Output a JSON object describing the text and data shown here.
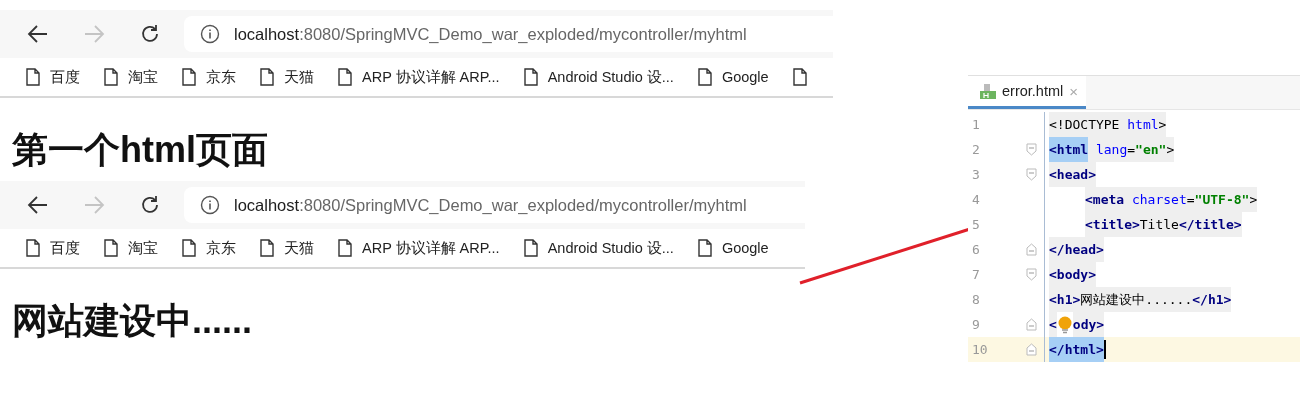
{
  "browsers": [
    {
      "nav": [
        {
          "kind": "back",
          "disabled": false
        },
        {
          "kind": "forward",
          "disabled": true
        },
        {
          "kind": "reload",
          "disabled": false
        }
      ],
      "address": {
        "host": "localhost",
        "path": ":8080/SpringMVC_Demo_war_exploded/mycontroller/myhtml"
      },
      "bookmarks": [
        "百度",
        "淘宝",
        "京东",
        "天猫",
        "ARP 协议详解 ARP...",
        "Android Studio 设...",
        "Google"
      ],
      "heading": "第一个html页面"
    },
    {
      "nav": [
        {
          "kind": "back",
          "disabled": false
        },
        {
          "kind": "forward",
          "disabled": true
        },
        {
          "kind": "reload",
          "disabled": false
        }
      ],
      "address": {
        "host": "localhost",
        "path": ":8080/SpringMVC_Demo_war_exploded/mycontroller/myhtml"
      },
      "bookmarks": [
        "百度",
        "淘宝",
        "京东",
        "天猫",
        "ARP 协议详解 ARP...",
        "Android Studio 设...",
        "Google"
      ],
      "heading": "网站建设中......"
    }
  ],
  "editor": {
    "tab": {
      "label": "error.html",
      "close": "×",
      "selected": true
    },
    "lines": [
      {
        "number": "1",
        "kind": "plain",
        "current": false,
        "tokens": [
          {
            "kind": "punct",
            "t": "<!DOCTYPE "
          },
          {
            "kind": "attr",
            "t": "html"
          },
          {
            "kind": "punct",
            "t": ">"
          }
        ]
      },
      {
        "number": "2",
        "kind": "opener",
        "current": false,
        "tokens": [
          {
            "kind": "tag",
            "t": "<html",
            "highlighted": true
          },
          {
            "kind": "attr",
            "t": " lang"
          },
          {
            "kind": "punct",
            "t": "="
          },
          {
            "kind": "string",
            "t": "\"en\""
          },
          {
            "kind": "punct",
            "t": ">"
          }
        ]
      },
      {
        "number": "3",
        "kind": "opener",
        "current": false,
        "tokens": [
          {
            "kind": "tag",
            "t": "<head>"
          }
        ],
        "children": [
          {
            "number": "4",
            "current": false,
            "tokens": [
              {
                "kind": "tag",
                "t": "<meta"
              },
              {
                "kind": "attr",
                "t": " charset"
              },
              {
                "kind": "punct",
                "t": "="
              },
              {
                "kind": "string",
                "t": "\"UTF-8\""
              },
              {
                "kind": "punct",
                "t": ">"
              }
            ]
          },
          {
            "number": "5",
            "current": false,
            "tokens": [
              {
                "kind": "tag",
                "t": "<title>"
              },
              {
                "kind": "text",
                "t": "Title"
              },
              {
                "kind": "tag",
                "t": "</title>"
              }
            ]
          }
        ]
      },
      {
        "number": "6",
        "kind": "closer",
        "current": false,
        "tokens": [
          {
            "kind": "tag",
            "t": "</head>"
          }
        ]
      },
      {
        "number": "7",
        "kind": "opener",
        "current": false,
        "tokens": [
          {
            "kind": "tag",
            "t": "<body>"
          }
        ]
      },
      {
        "number": "8",
        "kind": "plain",
        "current": false,
        "tokens": [
          {
            "kind": "tag",
            "t": "<h1>"
          },
          {
            "kind": "text",
            "t": "网站建设中......"
          },
          {
            "kind": "tag",
            "t": "</h1>"
          }
        ]
      },
      {
        "number": "9",
        "kind": "closer",
        "current": false,
        "tokens": [
          {
            "kind": "tag",
            "t": "<"
          },
          {
            "kind": "bulb"
          },
          {
            "kind": "tag",
            "t": "ody>"
          }
        ]
      },
      {
        "number": "10",
        "kind": "closer",
        "current": true,
        "tokens": [
          {
            "kind": "tag",
            "t": "</html>",
            "highlighted": true
          },
          {
            "kind": "caret"
          }
        ]
      }
    ]
  }
}
